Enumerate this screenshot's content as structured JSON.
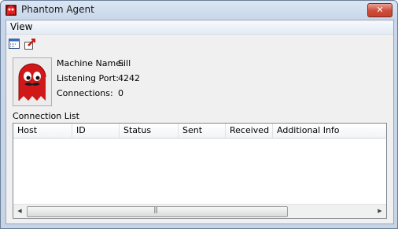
{
  "window": {
    "title": "Phantom Agent"
  },
  "menubar": {
    "items": [
      {
        "label": "View"
      }
    ]
  },
  "toolbar": {
    "icons": [
      "properties-icon",
      "disconnect-icon"
    ]
  },
  "agent": {
    "fields": [
      {
        "label": "Machine Name:",
        "value": "Sill"
      },
      {
        "label": "Listening Port:",
        "value": "4242"
      },
      {
        "label": "Connections:",
        "value": "0"
      }
    ]
  },
  "connection_list": {
    "label": "Connection List",
    "columns": [
      "Host",
      "ID",
      "Status",
      "Sent",
      "Received",
      "Additional Info"
    ],
    "rows": []
  },
  "colors": {
    "accent_red": "#d01818",
    "window_frame": "#c7d6ea"
  }
}
